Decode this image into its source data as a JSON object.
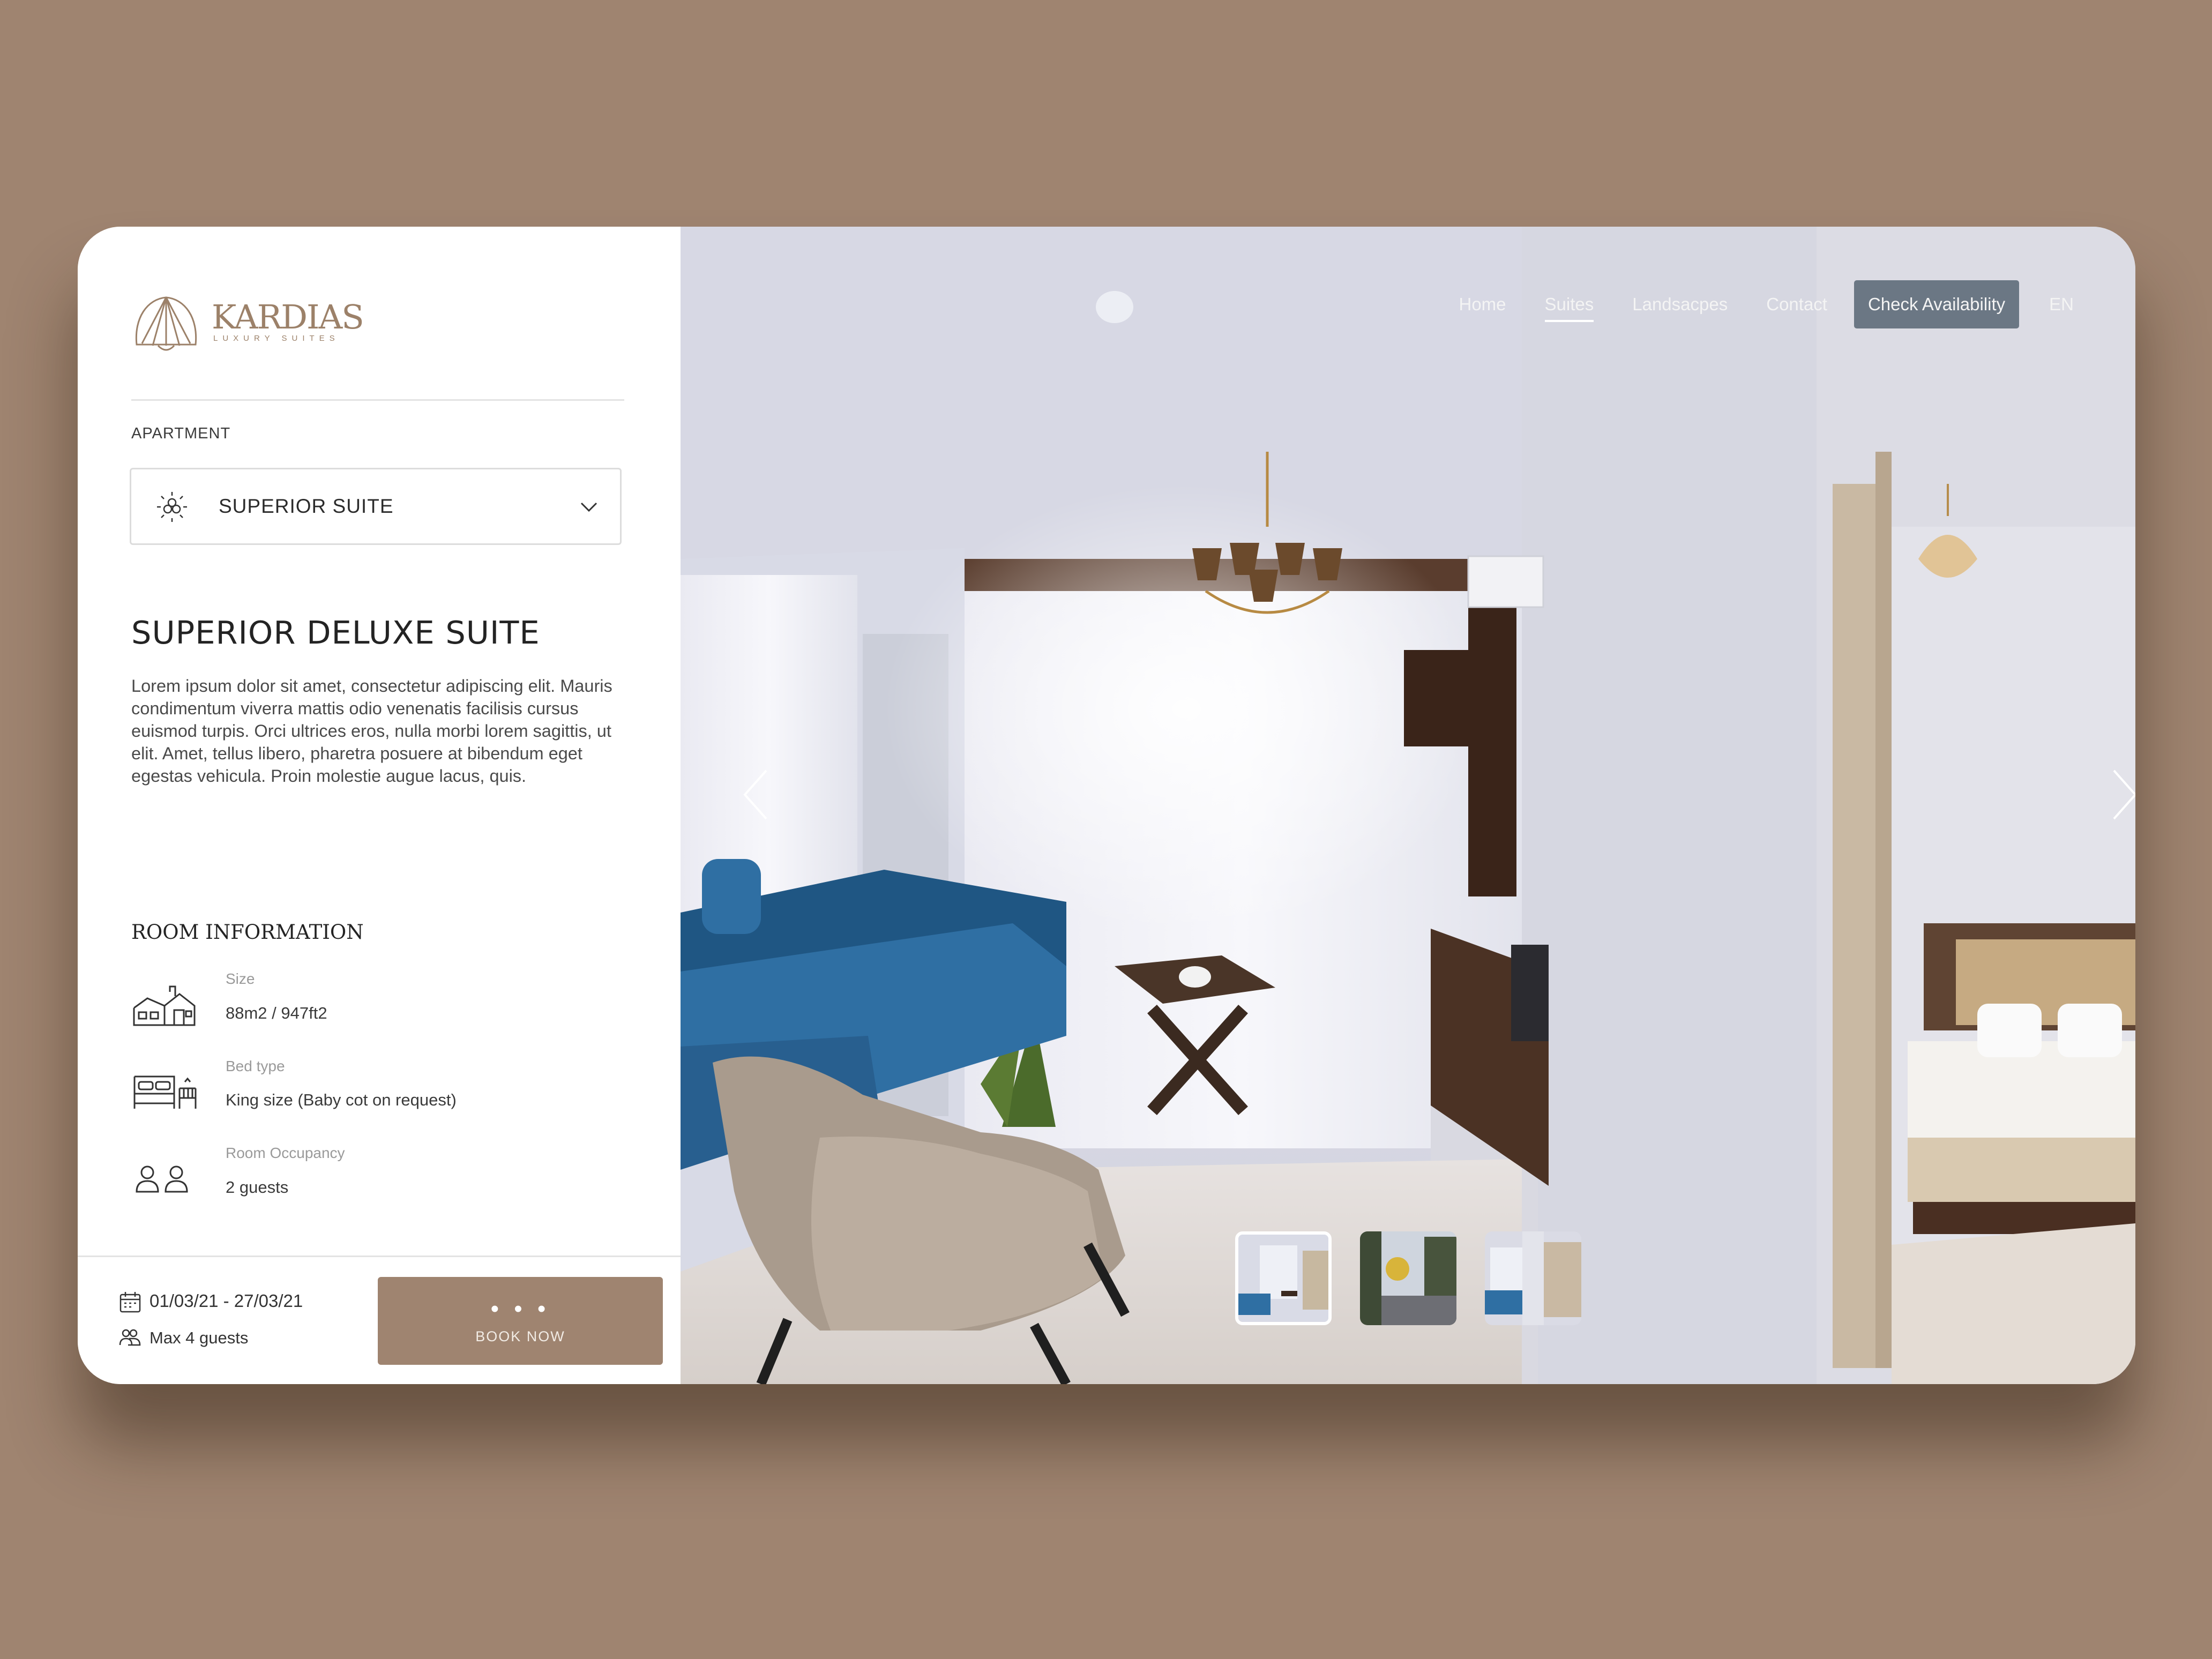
{
  "brand": {
    "name": "KARDIAS",
    "tagline": "LUXURY SUITES"
  },
  "apartment": {
    "label": "APARTMENT",
    "selected": "SUPERIOR SUITE"
  },
  "suite": {
    "title": "SUPERIOR DELUXE SUITE",
    "description": "Lorem ipsum dolor sit amet, consectetur adipiscing elit. Mauris condimentum viverra mattis odio venenatis facilisis cursus euismod turpis. Orci ultrices eros, nulla morbi lorem sagittis, ut elit. Amet, tellus libero, pharetra posuere at bibendum eget egestas vehicula. Proin molestie augue lacus, quis."
  },
  "room_info": {
    "title": "ROOM INFORMATION",
    "items": [
      {
        "label": "Size",
        "value": "88m2 / 947ft2",
        "icon": "house-icon"
      },
      {
        "label": "Bed type",
        "value": "King size  (Baby cot on request)",
        "icon": "bed-icon"
      },
      {
        "label": "Room Occupancy",
        "value": "2 guests",
        "icon": "guests-icon"
      }
    ]
  },
  "booking": {
    "dates": "01/03/21 - 27/03/21",
    "max_guests": "Max 4 guests",
    "button_dots": "• • •",
    "button_label": "BOOK NOW"
  },
  "nav": {
    "links": [
      "Home",
      "Suites",
      "Landsacpes",
      "Contact"
    ],
    "active": "Suites",
    "cta": "Check Availability",
    "language": "EN"
  },
  "gallery": {
    "thumbnails": 3,
    "active_index": 0
  },
  "colors": {
    "background": "#9f8470",
    "accent": "#9f8470",
    "cta": "#6b7784",
    "text": "#232323"
  }
}
